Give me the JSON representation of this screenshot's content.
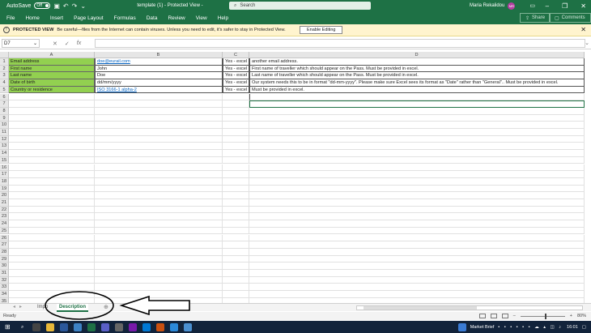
{
  "titlebar": {
    "autosave_label": "AutoSave",
    "autosave_state": "Off",
    "title": "template (1)  -  Protected View  -",
    "search_placeholder": "Search",
    "user_name": "Maria Rekalidou",
    "user_initials": "MR"
  },
  "menu": {
    "items": [
      "File",
      "Home",
      "Insert",
      "Page Layout",
      "Formulas",
      "Data",
      "Review",
      "View",
      "Help"
    ],
    "share_label": "Share",
    "comments_label": "Comments"
  },
  "protected_view": {
    "label": "PROTECTED VIEW",
    "message": "Be careful—files from the Internet can contain viruses. Unless you need to edit, it's safer to stay in Protected View.",
    "button": "Enable Editing"
  },
  "formula_bar": {
    "name_box": "D7",
    "cancel_icon": "✕",
    "enter_icon": "✓",
    "fx_label": "fx",
    "value": ""
  },
  "grid": {
    "columns": [
      "A",
      "B",
      "C",
      "D"
    ],
    "row_count": 35,
    "rows": [
      {
        "a": "Email address",
        "b": "doe@eurail.com",
        "c": "Yes - excel",
        "d": "another email address."
      },
      {
        "a": "First name",
        "b": "John",
        "c": "Yes - excel",
        "d": "First name of traveller which should appear on the Pass. Must be provided in excel."
      },
      {
        "a": "Last name",
        "b": "Doe",
        "c": "Yes - excel",
        "d": "Last name of traveller which should appear on the Pass. Must be provided in excel."
      },
      {
        "a": "Date of birth",
        "b": "dd/mm/yyyy",
        "c": "Yes - excel",
        "d": "Our system needs this to be in format \"dd-mm-yyyy\". Please make sure Excel sees its format as \"Date\" rather than \"General\".. Must be provided in excel."
      },
      {
        "a": "Country or residence",
        "b": "ISO 3166-1 alpha-2",
        "c": "Yes - excel",
        "d": "Must be provided in excel."
      }
    ]
  },
  "sheets": {
    "partial_tab": "Impo",
    "active_tab": "Description"
  },
  "status": {
    "ready": "Ready",
    "zoom": "80%"
  },
  "taskbar": {
    "market_label": "Market Brief",
    "time": "16:01"
  },
  "colors": {
    "excel_green": "#1e7145",
    "cell_green": "#92d050",
    "pv_yellow": "#fff4ce",
    "taskbar": "#12233b"
  }
}
